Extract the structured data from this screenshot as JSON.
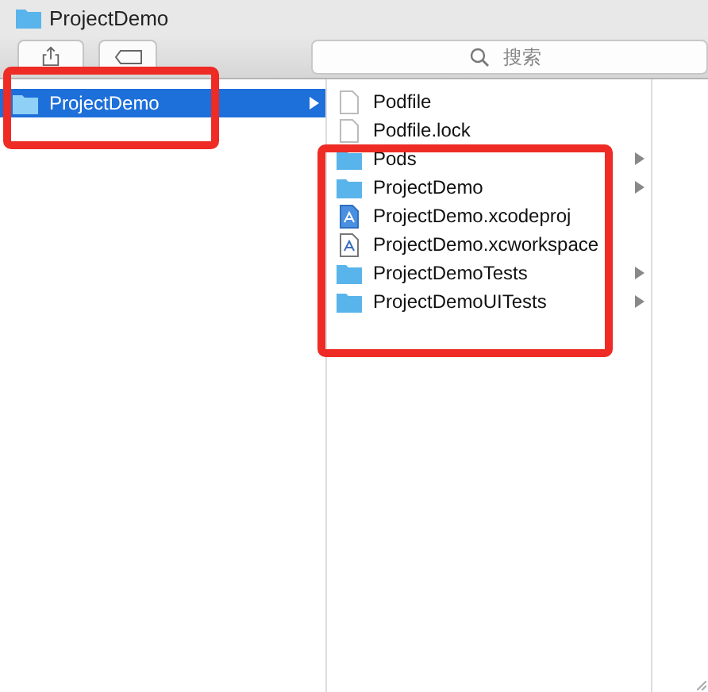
{
  "window": {
    "title": "ProjectDemo"
  },
  "toolbar": {
    "buttons": [
      {
        "kind": "share"
      },
      {
        "kind": "tag"
      }
    ],
    "search": {
      "placeholder": "搜索"
    }
  },
  "columns": [
    {
      "highlighted": true,
      "items": [
        {
          "name": "ProjectDemo",
          "kind": "folder",
          "selected": true,
          "has_children": true
        }
      ]
    },
    {
      "highlighted": true,
      "items": [
        {
          "name": "Podfile",
          "kind": "file",
          "selected": false,
          "has_children": false
        },
        {
          "name": "Podfile.lock",
          "kind": "file",
          "selected": false,
          "has_children": false
        },
        {
          "name": "Pods",
          "kind": "folder",
          "selected": false,
          "has_children": true
        },
        {
          "name": "ProjectDemo",
          "kind": "folder",
          "selected": false,
          "has_children": true
        },
        {
          "name": "ProjectDemo.xcodeproj",
          "kind": "project",
          "selected": false,
          "has_children": false
        },
        {
          "name": "ProjectDemo.xcworkspace",
          "kind": "workspace",
          "selected": false,
          "has_children": false
        },
        {
          "name": "ProjectDemoTests",
          "kind": "folder",
          "selected": false,
          "has_children": true
        },
        {
          "name": "ProjectDemoUITests",
          "kind": "folder",
          "selected": false,
          "has_children": true
        }
      ]
    }
  ]
}
